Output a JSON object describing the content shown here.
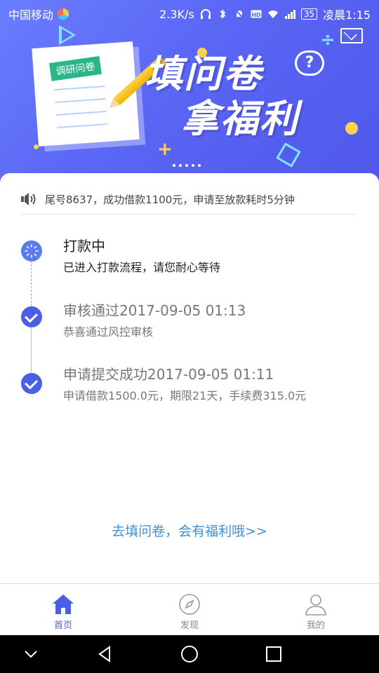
{
  "status_bar": {
    "carrier": "中国移动",
    "speed": "2.3K/s",
    "battery": "35",
    "time": "凌晨1:15",
    "icons": [
      "headset-icon",
      "bluetooth-icon",
      "mute-icon",
      "hd-icon",
      "wifi-icon",
      "signal-icon"
    ]
  },
  "banner": {
    "title_line1": "填问卷",
    "title_line2": "拿福利",
    "paper_tag": "调研问卷",
    "colors": {
      "top": "#6a7dff",
      "bottom": "#4f58ea",
      "accent": "#ffd24d",
      "cyan": "#7ee6ff"
    }
  },
  "notice": {
    "text": "尾号8637，成功借款1100元，申请至放款耗时5分钟",
    "icon": "speaker-icon"
  },
  "timeline": [
    {
      "title": "打款中",
      "subtitle": "已进入打款流程，请您耐心等待",
      "status": "in-progress"
    },
    {
      "title": "审核通过2017-09-05 01:13",
      "subtitle": "恭喜通过风控审核",
      "status": "done"
    },
    {
      "title": "申请提交成功2017-09-05 01:11",
      "subtitle": "申请借款1500.0元，期限21天，手续费315.0元",
      "status": "done"
    }
  ],
  "survey_link": "去填问卷，会有福利哦>>",
  "tabs": [
    {
      "label": "首页",
      "icon": "home-icon",
      "active": true
    },
    {
      "label": "发现",
      "icon": "compass-icon",
      "active": false
    },
    {
      "label": "我的",
      "icon": "user-icon",
      "active": false
    }
  ],
  "colors": {
    "primary": "#4a5fe8",
    "link": "#3f8fd8"
  }
}
